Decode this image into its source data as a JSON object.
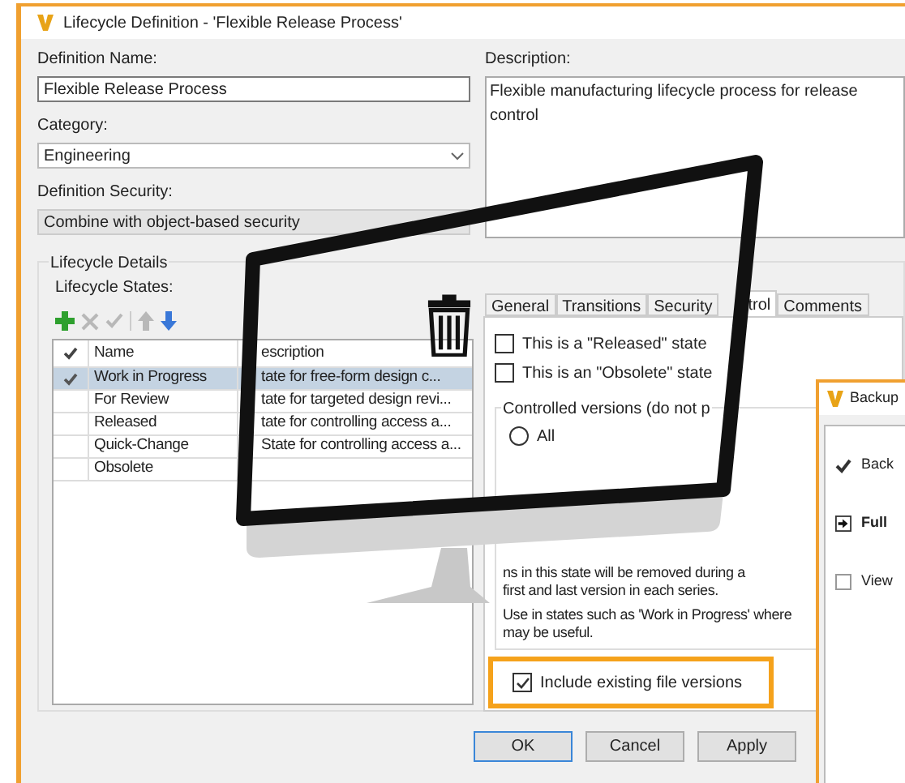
{
  "window": {
    "title": "Lifecycle Definition - 'Flexible Release Process'"
  },
  "definition_name": {
    "label": "Definition Name:",
    "value": "Flexible Release Process"
  },
  "category": {
    "label": "Category:",
    "value": "Engineering"
  },
  "definition_security": {
    "label": "Definition Security:",
    "value": "Combine with object-based security",
    "disabled": true
  },
  "description": {
    "label": "Description:",
    "value": "Flexible manufacturing lifecycle process for release control"
  },
  "lifecycle_details": {
    "title": "Lifecycle Details",
    "states_label": "Lifecycle States:",
    "toolbar": [
      {
        "kind": "add",
        "disabled": false
      },
      {
        "kind": "delete",
        "disabled": true
      },
      {
        "kind": "default",
        "disabled": true
      },
      {
        "kind": "up",
        "disabled": true
      },
      {
        "kind": "down",
        "disabled": false
      }
    ],
    "columns": [
      "Name",
      "escription"
    ],
    "rows": [
      {
        "name": "Work in Progress",
        "description": "tate for free-form design c...",
        "checked": true,
        "selected": true
      },
      {
        "name": "For Review",
        "description": "tate for targeted design revi...",
        "checked": false,
        "selected": false
      },
      {
        "name": "Released",
        "description": "tate for controlling access a...",
        "checked": false,
        "selected": false
      },
      {
        "name": "Quick-Change",
        "description": "State for controlling access a...",
        "checked": false,
        "selected": false
      },
      {
        "name": "Obsolete",
        "description": "",
        "checked": false,
        "selected": false
      }
    ]
  },
  "tabs": [
    {
      "label": "General",
      "selected": false
    },
    {
      "label": "Transitions",
      "selected": false
    },
    {
      "label": "Security",
      "selected": false
    },
    {
      "label": "trol",
      "selected": true
    },
    {
      "label": "Comments",
      "selected": false
    }
  ],
  "control_tab": {
    "checkboxes": [
      {
        "label": "This is a \"Released\" state",
        "checked": false
      },
      {
        "label": "This is an \"Obsolete\" state",
        "checked": false
      }
    ],
    "group_title": "Controlled versions (do not p",
    "radios": [
      {
        "label": "All",
        "selected": false
      }
    ],
    "notes": [
      "ns in this state will be removed during a",
      "first and last version in each series.",
      "Use in states such as 'Work in Progress' where",
      "may be useful."
    ],
    "include_versions": {
      "label": "Include existing file versions",
      "checked": true
    }
  },
  "buttons": [
    "OK",
    "Cancel",
    "Apply"
  ],
  "backup_dialog": {
    "title": "Backup",
    "items": [
      {
        "kind": "check",
        "label": "Back"
      },
      {
        "kind": "arrow",
        "label": "Full"
      },
      {
        "kind": "checkbox",
        "label": "View",
        "checked": false
      }
    ]
  }
}
